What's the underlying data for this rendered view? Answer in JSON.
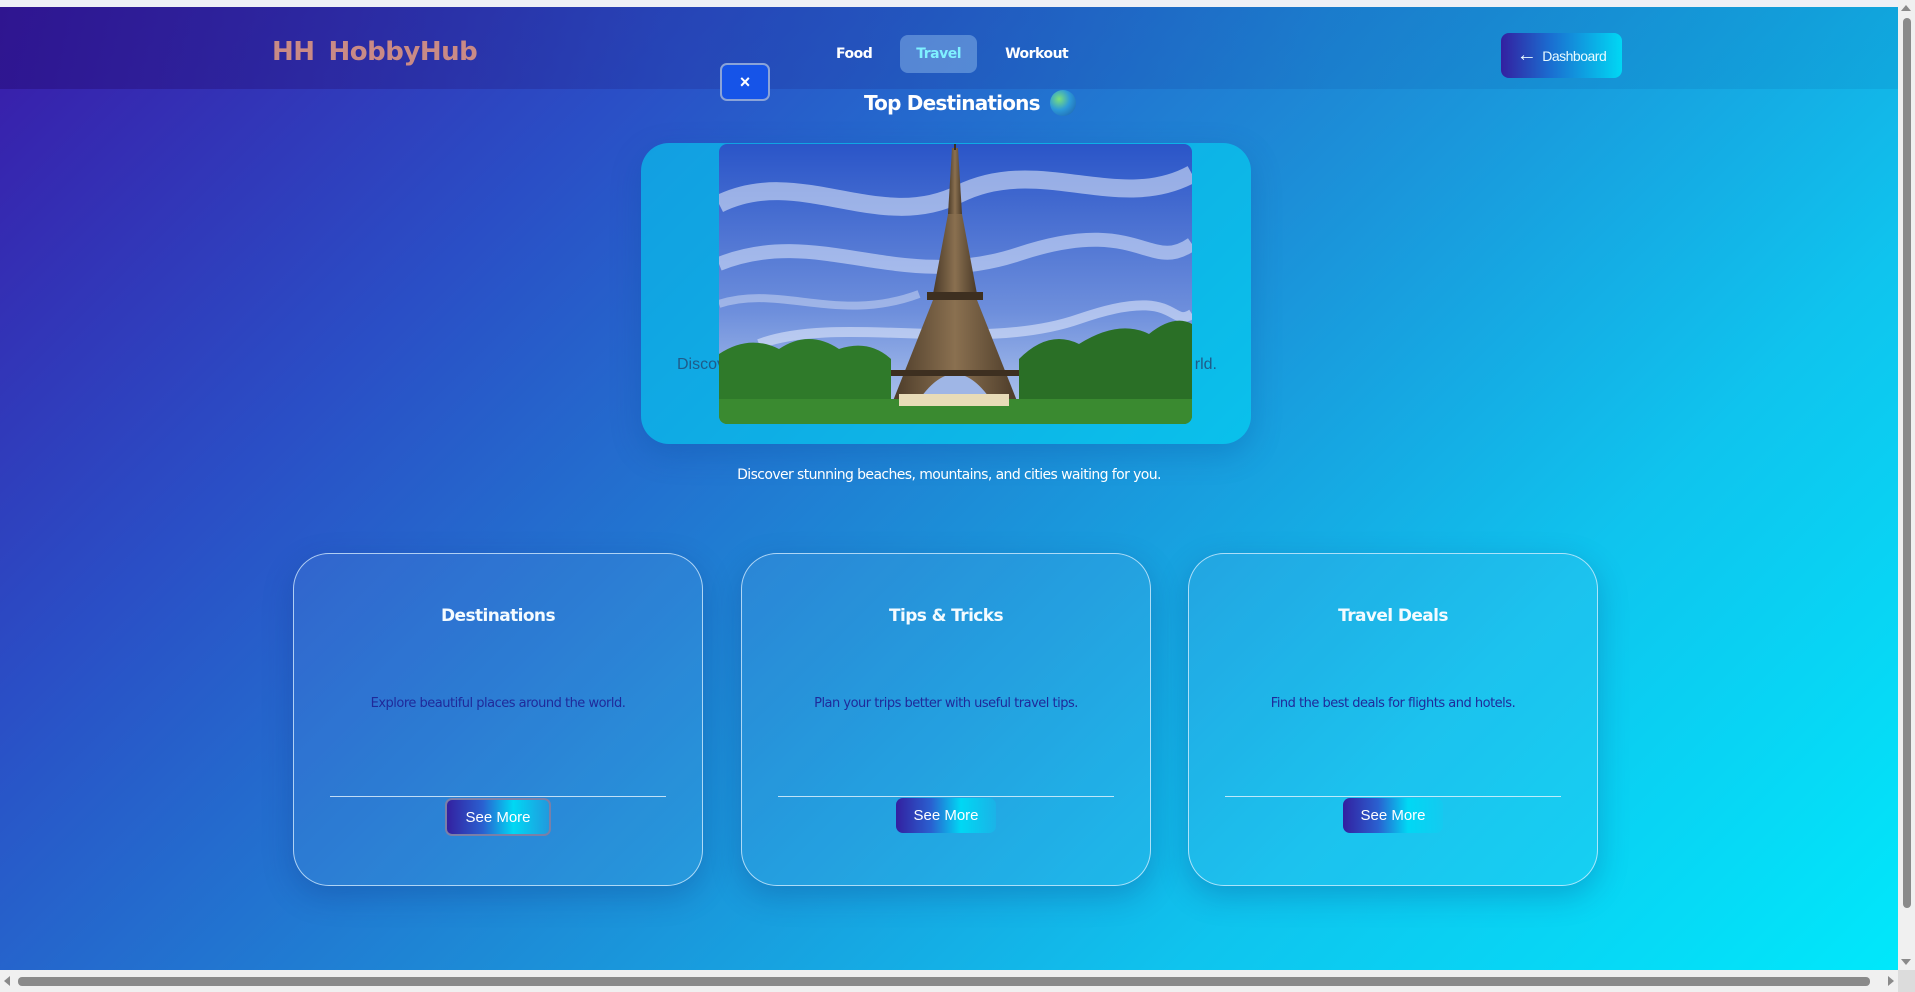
{
  "brand": {
    "logo_text": "HH",
    "name": "HobbyHub"
  },
  "nav": {
    "items": [
      {
        "label": "Food",
        "active": false
      },
      {
        "label": "Travel",
        "active": true
      },
      {
        "label": "Workout",
        "active": false
      }
    ]
  },
  "dashboard_button": {
    "label": "Dashboard",
    "icon": "arrow-left-icon"
  },
  "modal": {
    "close_label": "×"
  },
  "hero": {
    "title": "Top Destinations",
    "title_icon": "globe-icon",
    "behind_text_start": "Discov",
    "behind_text_end": "rld.",
    "subtitle": "Discover stunning beaches, mountains, and cities waiting for you."
  },
  "cards": [
    {
      "title": "Destinations",
      "description": "Explore beautiful places around the world.",
      "button": "See More"
    },
    {
      "title": "Tips & Tricks",
      "description": "Plan your trips better with useful travel tips.",
      "button": "See More"
    },
    {
      "title": "Travel Deals",
      "description": "Find the best deals for flights and hotels.",
      "button": "See More"
    }
  ],
  "colors": {
    "accent": "#1654e8",
    "brand_text": "#c98a86",
    "gradient_start": "#3a1aa8",
    "gradient_end": "#00e8fb"
  }
}
